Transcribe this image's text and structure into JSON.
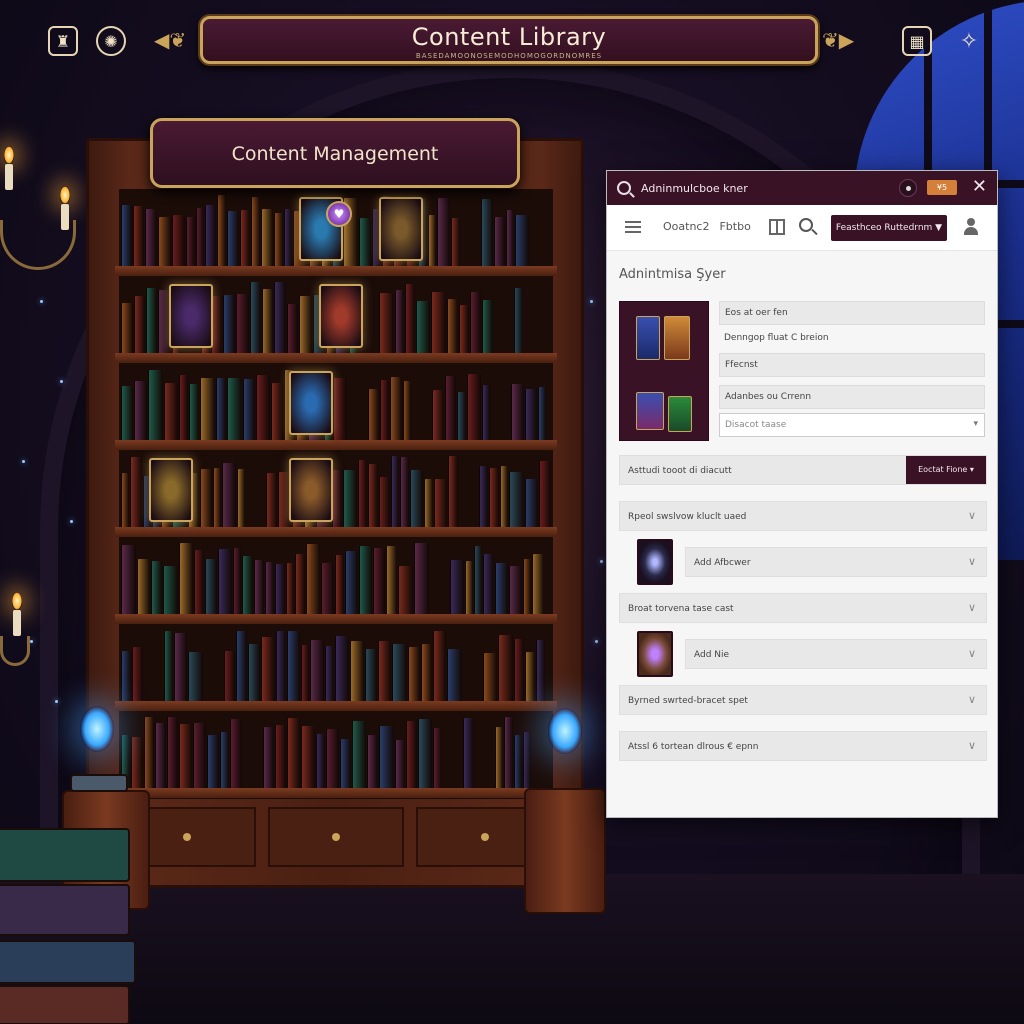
{
  "top_bar": {
    "title": "Content Library",
    "subtitle": "BASEDAMOONOSEMODHOMOGORDNOMRES",
    "left_icons": [
      "bell-icon",
      "gear-icon"
    ],
    "right_icons": [
      "calculator-icon",
      "magic-sparkle-icon"
    ]
  },
  "bookshelf": {
    "sign_title": "Content Management"
  },
  "admin_panel": {
    "titlebar": {
      "title": "Adninmulcboe kner",
      "badge": "¥5"
    },
    "toolbar": {
      "nav_items": [
        "Ooatnc2 ",
        "Fbtbo"
      ],
      "button_label": "Feasthceo Ruttedrnm ▼"
    },
    "section_title": "Adnintmisa Şyer",
    "fields": [
      {
        "value": "Eos at oer fen",
        "style": "filled"
      },
      {
        "value": "Denngop fluat C breion",
        "style": "plain"
      },
      {
        "value": "Ffecnst",
        "style": "filled"
      },
      {
        "value": "Adanbes ou Crrenn",
        "style": "filled"
      },
      {
        "value": "Disacot taase",
        "style": "select"
      }
    ],
    "rows": [
      {
        "label": "Asttudi tooot di diacutt",
        "button": "Eoctat Fione"
      },
      {
        "label": "Rpeol swslvow kluclt uaed"
      },
      {
        "label": "Add Afbcwer",
        "thumb": true
      },
      {
        "label": "Broat torvena tase cast"
      },
      {
        "label": "Add Nie",
        "thumb": true
      },
      {
        "label": "Byrned swrted-bracet spet"
      },
      {
        "label": "Atssl 6 tortean dlrous € epnn"
      }
    ]
  },
  "colors": {
    "accent": "#3a1226",
    "gold": "#c9a45a",
    "panel_bg": "#f6f6f6"
  }
}
